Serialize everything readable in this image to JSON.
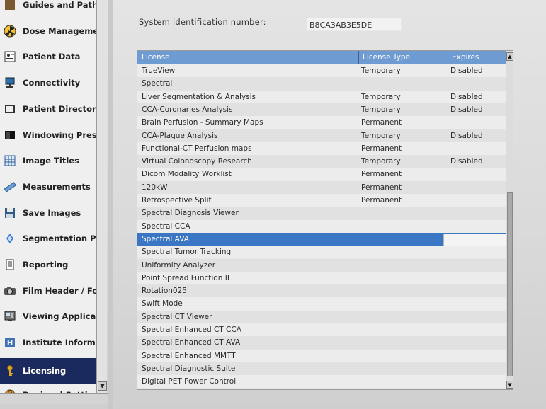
{
  "sidebar": {
    "items": [
      {
        "label": "Guides and Paths",
        "icon": "guides-icon",
        "active": false
      },
      {
        "label": "Dose Management",
        "icon": "radiation-icon",
        "active": false
      },
      {
        "label": "Patient Data",
        "icon": "patient-data-icon",
        "active": false
      },
      {
        "label": "Connectivity",
        "icon": "network-icon",
        "active": false
      },
      {
        "label": "Patient Directory",
        "icon": "directory-icon",
        "active": false
      },
      {
        "label": "Windowing Presets",
        "icon": "windowing-icon",
        "active": false
      },
      {
        "label": "Image Titles",
        "icon": "grid-icon",
        "active": false
      },
      {
        "label": "Measurements",
        "icon": "ruler-icon",
        "active": false
      },
      {
        "label": "Save Images",
        "icon": "floppy-icon",
        "active": false
      },
      {
        "label": "Segmentation Presets",
        "icon": "segmentation-icon",
        "active": false
      },
      {
        "label": "Reporting",
        "icon": "report-icon",
        "active": false
      },
      {
        "label": "Film Header / Footer",
        "icon": "camera-icon",
        "active": false
      },
      {
        "label": "Viewing Applications",
        "icon": "viewing-icon",
        "active": false
      },
      {
        "label": "Institute Information",
        "icon": "hospital-icon",
        "active": false
      },
      {
        "label": "Licensing",
        "icon": "key-icon",
        "active": true
      },
      {
        "label": "Regional Settings",
        "icon": "globe-icon",
        "active": false
      }
    ]
  },
  "system_id": {
    "label": "System identification number:",
    "value": "B8CA3AB3E5DE"
  },
  "license_table": {
    "columns": [
      "License",
      "License Type",
      "Expires"
    ],
    "rows": [
      {
        "license": "TrueView",
        "type": "Temporary",
        "expires": "Disabled"
      },
      {
        "license": "Spectral",
        "type": "",
        "expires": ""
      },
      {
        "license": "Liver Segmentation & Analysis",
        "type": "Temporary",
        "expires": "Disabled"
      },
      {
        "license": "CCA-Coronaries Analysis",
        "type": "Temporary",
        "expires": "Disabled"
      },
      {
        "license": "Brain Perfusion - Summary Maps",
        "type": "Permanent",
        "expires": ""
      },
      {
        "license": "CCA-Plaque Analysis",
        "type": "Temporary",
        "expires": "Disabled"
      },
      {
        "license": "Functional-CT Perfusion maps",
        "type": "Permanent",
        "expires": ""
      },
      {
        "license": "Virtual Colonoscopy Research",
        "type": "Temporary",
        "expires": "Disabled"
      },
      {
        "license": "Dicom Modality Worklist",
        "type": "Permanent",
        "expires": ""
      },
      {
        "license": "120kW",
        "type": "Permanent",
        "expires": ""
      },
      {
        "license": "Retrospective Split",
        "type": "Permanent",
        "expires": ""
      },
      {
        "license": "Spectral Diagnosis Viewer",
        "type": "",
        "expires": ""
      },
      {
        "license": "Spectral CCA",
        "type": "",
        "expires": ""
      },
      {
        "license": "Spectral AVA",
        "type": "",
        "expires": ""
      },
      {
        "license": "Spectral Tumor Tracking",
        "type": "",
        "expires": ""
      },
      {
        "license": "Uniformity Analyzer",
        "type": "",
        "expires": ""
      },
      {
        "license": "Point Spread Function II",
        "type": "",
        "expires": ""
      },
      {
        "license": "Rotation025",
        "type": "",
        "expires": ""
      },
      {
        "license": "Swift Mode",
        "type": "",
        "expires": ""
      },
      {
        "license": "Spectral CT Viewer",
        "type": "",
        "expires": ""
      },
      {
        "license": "Spectral Enhanced CT CCA",
        "type": "",
        "expires": ""
      },
      {
        "license": "Spectral Enhanced CT AVA",
        "type": "",
        "expires": ""
      },
      {
        "license": "Spectral Enhanced MMTT",
        "type": "",
        "expires": ""
      },
      {
        "license": "Spectral Diagnostic Suite",
        "type": "",
        "expires": ""
      },
      {
        "license": "Digital PET Power Control",
        "type": "",
        "expires": ""
      }
    ],
    "selected_index": 13
  },
  "colors": {
    "header": "#6f9bd3",
    "selected_row": "#3a76c4",
    "active_sidebar": "#1b2a5e"
  }
}
